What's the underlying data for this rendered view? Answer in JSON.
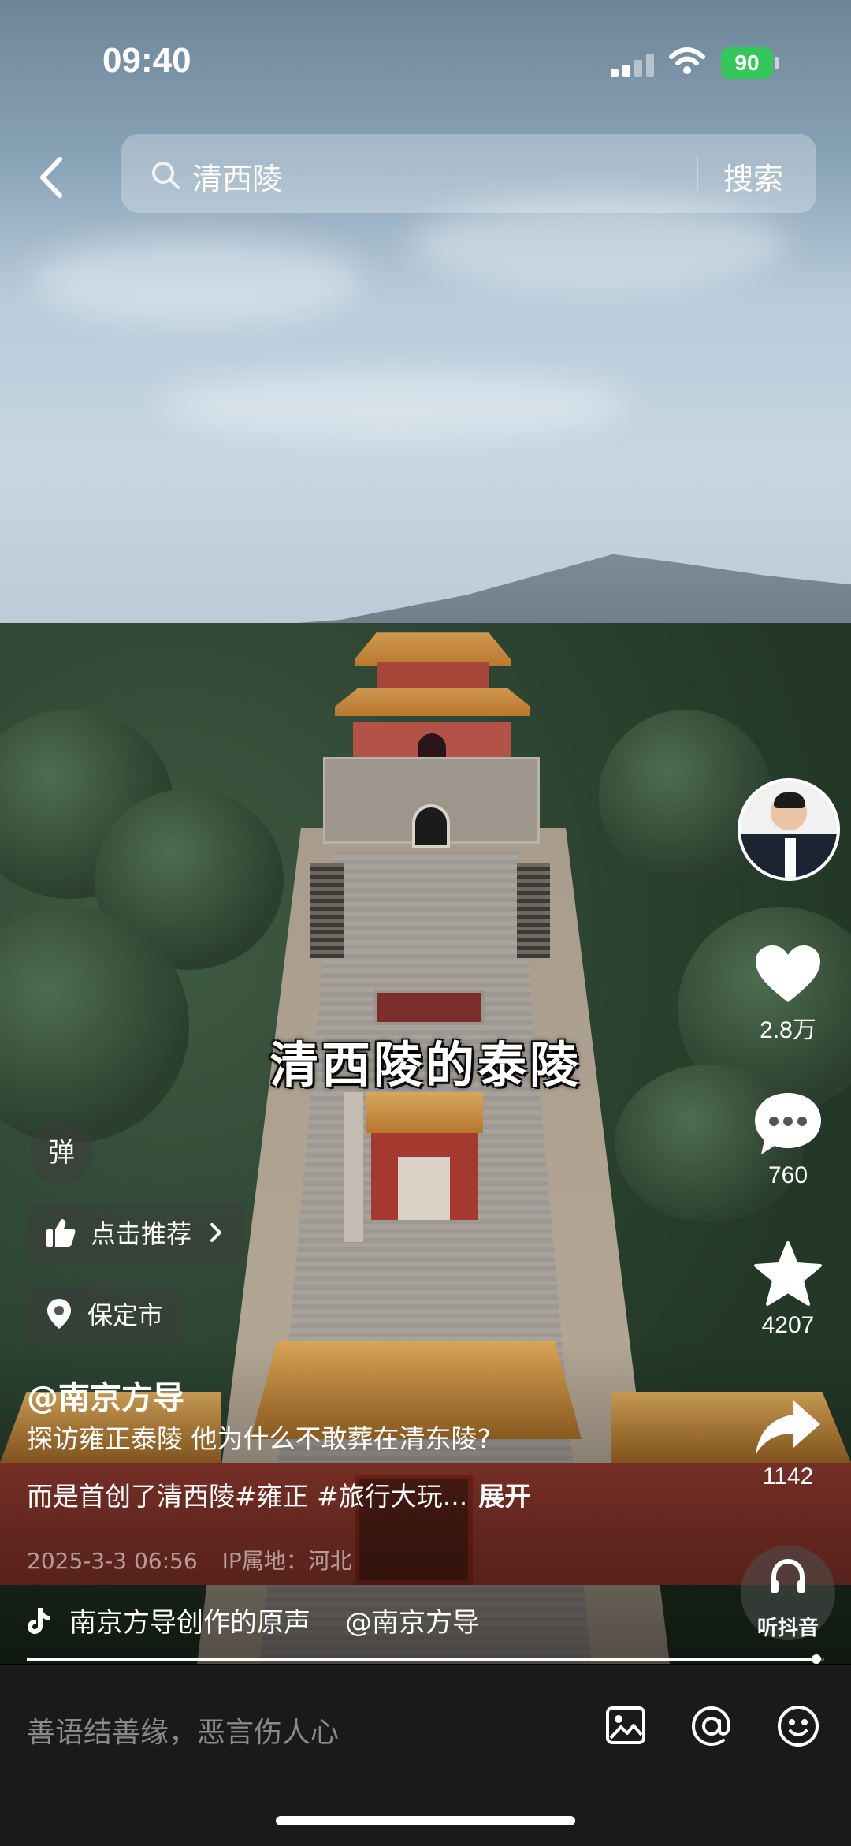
{
  "status_bar": {
    "time": "09:40",
    "battery": "90"
  },
  "search": {
    "query": "清西陵",
    "button_label": "搜索"
  },
  "video": {
    "caption": "清西陵的泰陵",
    "progress": 0.99
  },
  "actions": {
    "likes": "2.8万",
    "comments": "760",
    "favorites": "4207",
    "shares": "1142",
    "listen_label": "听抖音"
  },
  "overlay": {
    "danmu_label": "弹",
    "recommend_label": "点击推荐",
    "location_label": "保定市"
  },
  "post": {
    "author": "@南京方导",
    "description_line1": "探访雍正泰陵 他为什么不敢葬在清东陵?",
    "description_line2": "而是首创了清西陵#雍正 #旅行大玩...",
    "expand_label": "展开",
    "date": "2025-3-3 06:56",
    "ip_location": "IP属地：河北",
    "music_title": "南京方导创作的原声",
    "music_author": "@南京方导"
  },
  "comment_bar": {
    "placeholder": "善语结善缘，恶言伤人心"
  },
  "icons": {
    "back": "chevron-left-icon",
    "search": "search-icon",
    "like": "heart-icon",
    "comment": "speech-bubble-icon",
    "favorite": "star-icon",
    "share": "share-arrow-icon",
    "listen": "headphones-icon",
    "recommend": "thumbs-up-icon",
    "location": "location-pin-icon",
    "music": "tiktok-note-icon",
    "image": "image-icon",
    "mention": "at-icon",
    "emoji": "emoji-icon"
  },
  "colors": {
    "battery": "#35c759",
    "comment_bar": "#1a1a1a"
  }
}
